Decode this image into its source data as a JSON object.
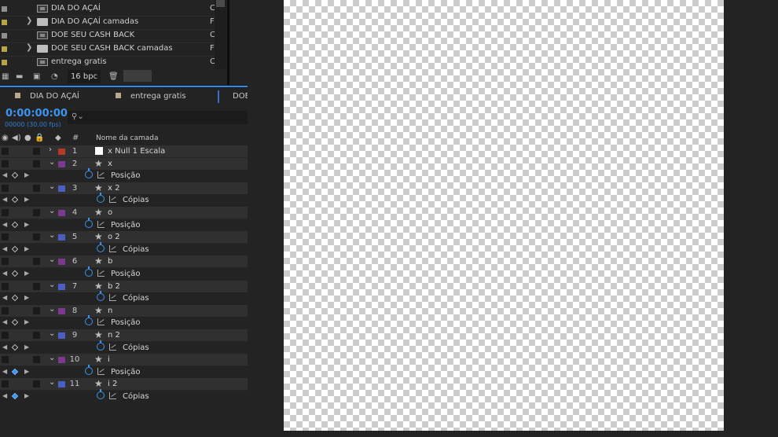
{
  "project": {
    "items": [
      {
        "type": "comp",
        "swatch": "#8f8f8f",
        "name": "DIA DO AÇAÍ",
        "col": "C",
        "twisty": ""
      },
      {
        "type": "folder",
        "swatch": "#b8a545",
        "name": "DIA DO AÇAÍ camadas",
        "col": "F",
        "twisty": "❯"
      },
      {
        "type": "comp",
        "swatch": "#8f8f8f",
        "name": "DOE SEU CASH BACK",
        "col": "C",
        "twisty": ""
      },
      {
        "type": "folder",
        "swatch": "#b8a545",
        "name": "DOE SEU CASH BACK camadas",
        "col": "F",
        "twisty": "❯"
      },
      {
        "type": "comp",
        "swatch": "#b8a545",
        "name": "entrega gratis",
        "col": "C",
        "twisty": ""
      }
    ],
    "bpc": "16 bpc"
  },
  "timeline": {
    "tabs": [
      "DIA DO AÇAÍ",
      "entrega gratis",
      "DOE"
    ],
    "timecode": "0:00:00:00",
    "frames": "00000 (30.00 fps)",
    "column_header": "Nome da camada",
    "number_header": "#",
    "rows": [
      {
        "kind": "layer",
        "num": "1",
        "name": "x Null 1 Escala",
        "label_color": "#b23b2b",
        "solid": true,
        "expanded": false
      },
      {
        "kind": "layer",
        "num": "2",
        "name": "x",
        "label_color": "#7b3a8f",
        "expanded": true
      },
      {
        "kind": "prop",
        "name": "Posição",
        "indent": 0,
        "kf_on": false
      },
      {
        "kind": "layer",
        "num": "3",
        "name": "x 2",
        "label_color": "#4a5fc1",
        "expanded": true
      },
      {
        "kind": "prop",
        "name": "Cópias",
        "indent": 1,
        "kf_on": false
      },
      {
        "kind": "layer",
        "num": "4",
        "name": "o",
        "label_color": "#7b3a8f",
        "expanded": true
      },
      {
        "kind": "prop",
        "name": "Posição",
        "indent": 0,
        "kf_on": false
      },
      {
        "kind": "layer",
        "num": "5",
        "name": "o 2",
        "label_color": "#4a5fc1",
        "expanded": true
      },
      {
        "kind": "prop",
        "name": "Cópias",
        "indent": 1,
        "kf_on": false
      },
      {
        "kind": "layer",
        "num": "6",
        "name": "b",
        "label_color": "#7b3a8f",
        "expanded": true
      },
      {
        "kind": "prop",
        "name": "Posição",
        "indent": 0,
        "kf_on": false
      },
      {
        "kind": "layer",
        "num": "7",
        "name": "b 2",
        "label_color": "#4a5fc1",
        "expanded": true
      },
      {
        "kind": "prop",
        "name": "Cópias",
        "indent": 1,
        "kf_on": false
      },
      {
        "kind": "layer",
        "num": "8",
        "name": "n",
        "label_color": "#7b3a8f",
        "expanded": true
      },
      {
        "kind": "prop",
        "name": "Posição",
        "indent": 0,
        "kf_on": false
      },
      {
        "kind": "layer",
        "num": "9",
        "name": "n 2",
        "label_color": "#4a5fc1",
        "expanded": true
      },
      {
        "kind": "prop",
        "name": "Cópias",
        "indent": 1,
        "kf_on": false
      },
      {
        "kind": "layer",
        "num": "10",
        "name": "i",
        "label_color": "#7b3a8f",
        "expanded": true
      },
      {
        "kind": "prop",
        "name": "Posição",
        "indent": 0,
        "kf_on": true
      },
      {
        "kind": "layer",
        "num": "11",
        "name": "i 2",
        "label_color": "#4a5fc1",
        "expanded": true
      },
      {
        "kind": "prop",
        "name": "Cópias",
        "indent": 1,
        "kf_on": true
      }
    ]
  },
  "colors": {
    "accent": "#3a94f0",
    "panel_bg": "#232323",
    "layer_row_bg": "#303030"
  }
}
